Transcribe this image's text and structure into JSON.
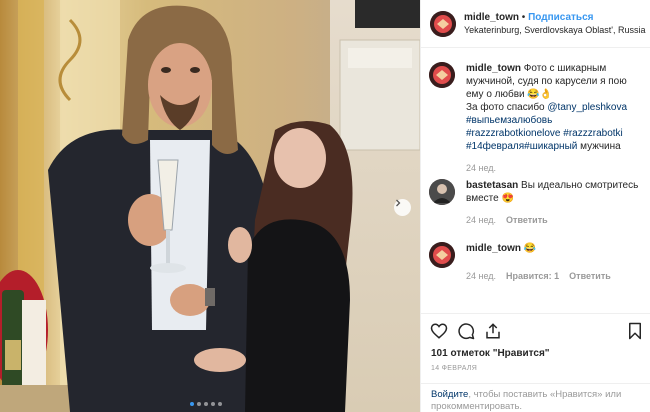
{
  "header": {
    "username": "midle_town",
    "separator": "•",
    "follow_label": "Подписаться",
    "location": "Yekaterinburg, Sverdlovskaya Oblast', Russia"
  },
  "caption": {
    "username": "midle_town",
    "text": "Фото с шикарным мужчиной, судя по карусели я пою ему о любви 😂👌",
    "thanks_prefix": "За фото спасибо",
    "mention": "@tany_pleshkova",
    "hashtag_1": "#выпьемзалюбовь",
    "hashtag_2": "#razzzrabotkionelove",
    "hashtag_3": "#razzzrabotki",
    "hashtag_4": "#14февраля",
    "hashtag_5": "#шикарный",
    "tail": "мужчина",
    "time": "24 нед."
  },
  "comments": [
    {
      "username": "bastetasan",
      "text": "Вы идеально смотритесь вместе 😍",
      "time": "24 нед.",
      "reply_label": "Ответить"
    },
    {
      "username": "midle_town",
      "text": "😂",
      "time": "24 нед.",
      "likes_label": "Нравится: 1",
      "reply_label": "Ответить"
    }
  ],
  "actions": {
    "likes": "101 отметок \"Нравится\"",
    "date": "14 ФЕВРАЛЯ",
    "login_link": "Войдите",
    "login_text": ", чтобы поставить «Нравится» или прокомментировать."
  },
  "carousel": {
    "total": 5,
    "active": 0
  },
  "colors": {
    "accent": "#3897f0",
    "link": "#003569",
    "muted": "#999999",
    "border": "#efefef"
  },
  "icons": [
    "chevron-right-icon",
    "heart-icon",
    "comment-icon",
    "share-icon",
    "bookmark-icon"
  ]
}
